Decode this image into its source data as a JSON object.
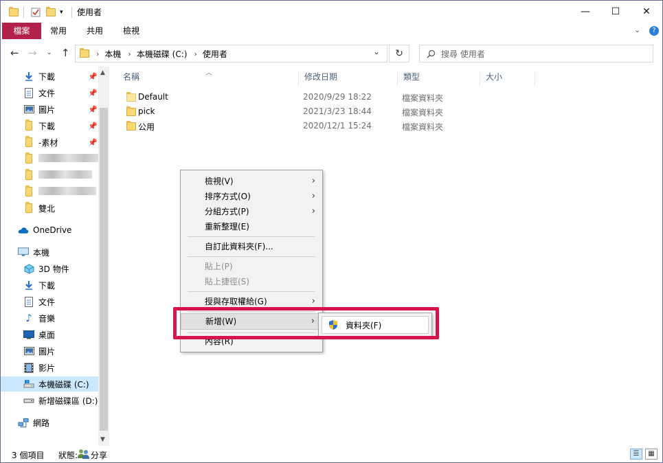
{
  "window": {
    "title": "使用者",
    "minimize_glyph": "—",
    "maximize_glyph": "☐",
    "close_glyph": "✕"
  },
  "ribbon": {
    "tabs": [
      "檔案",
      "常用",
      "共用",
      "檢視"
    ],
    "collapse_glyph": "⌄",
    "help_glyph": "?"
  },
  "address": {
    "crumbs": [
      "本機",
      "本機磁碟 (C:)",
      "使用者"
    ],
    "separator": "›",
    "dropdown_glyph": "⌄",
    "refresh_glyph": "↻",
    "search_placeholder": "搜尋 使用者"
  },
  "sidebar": {
    "quick_access": [
      {
        "label": "下載",
        "icon": "download-icon",
        "pinned": true
      },
      {
        "label": "文件",
        "icon": "document-icon",
        "pinned": true
      },
      {
        "label": "圖片",
        "icon": "picture-icon",
        "pinned": true
      },
      {
        "label": "下載",
        "icon": "folder-icon",
        "pinned": true
      },
      {
        "label": "-素材",
        "icon": "folder-icon",
        "pinned": true
      },
      {
        "label": "",
        "icon": "folder-icon",
        "pinned": false
      },
      {
        "label": "",
        "icon": "folder-icon",
        "pinned": false
      },
      {
        "label": "",
        "icon": "folder-icon",
        "pinned": false
      },
      {
        "label": "雙北",
        "icon": "folder-icon",
        "pinned": false
      }
    ],
    "onedrive": "OneDrive",
    "this_pc": "本機",
    "pc_items": [
      {
        "label": "3D 物件",
        "icon": "3d-objects-icon"
      },
      {
        "label": "下載",
        "icon": "download-icon"
      },
      {
        "label": "文件",
        "icon": "document-icon"
      },
      {
        "label": "音樂",
        "icon": "music-icon"
      },
      {
        "label": "桌面",
        "icon": "desktop-icon"
      },
      {
        "label": "圖片",
        "icon": "picture-icon"
      },
      {
        "label": "影片",
        "icon": "video-icon"
      },
      {
        "label": "本機磁碟 (C:)",
        "icon": "drive-icon",
        "selected": true
      },
      {
        "label": "新增磁碟區 (D:)",
        "icon": "drive-icon"
      }
    ],
    "network": "網路"
  },
  "columns": [
    "名稱",
    "修改日期",
    "類型",
    "大小"
  ],
  "files": [
    {
      "name": "Default",
      "date": "2020/9/29 18:22",
      "type": "檔案資料夾"
    },
    {
      "name": "pick",
      "date": "2021/3/23 18:44",
      "type": "檔案資料夾"
    },
    {
      "name": "公用",
      "date": "2020/12/1 15:24",
      "type": "檔案資料夾"
    }
  ],
  "context_menu": {
    "items": [
      {
        "label": "檢視(V)",
        "submenu": true,
        "disabled": false
      },
      {
        "label": "排序方式(O)",
        "submenu": true,
        "disabled": false
      },
      {
        "label": "分組方式(P)",
        "submenu": true,
        "disabled": false
      },
      {
        "label": "重新整理(E)",
        "submenu": false,
        "disabled": false
      },
      {
        "label": "自訂此資料夾(F)...",
        "submenu": false,
        "disabled": false
      },
      {
        "label": "貼上(P)",
        "submenu": false,
        "disabled": true
      },
      {
        "label": "貼上捷徑(S)",
        "submenu": false,
        "disabled": true
      },
      {
        "label": "授與存取權給(G)",
        "submenu": true,
        "disabled": false
      },
      {
        "label": "新增(W)",
        "submenu": true,
        "disabled": false,
        "highlighted": true
      },
      {
        "label": "內容(R)",
        "submenu": false,
        "disabled": false
      }
    ],
    "submenu_arrow": "›",
    "submenu_new": "資料夾(F)"
  },
  "status": {
    "count": "3 個項目",
    "state_label": "狀態:",
    "state_value": "分享"
  },
  "colors": {
    "file_tab": "#b3204a",
    "highlight_frame": "#d6134a",
    "selection": "#cce8ff"
  }
}
